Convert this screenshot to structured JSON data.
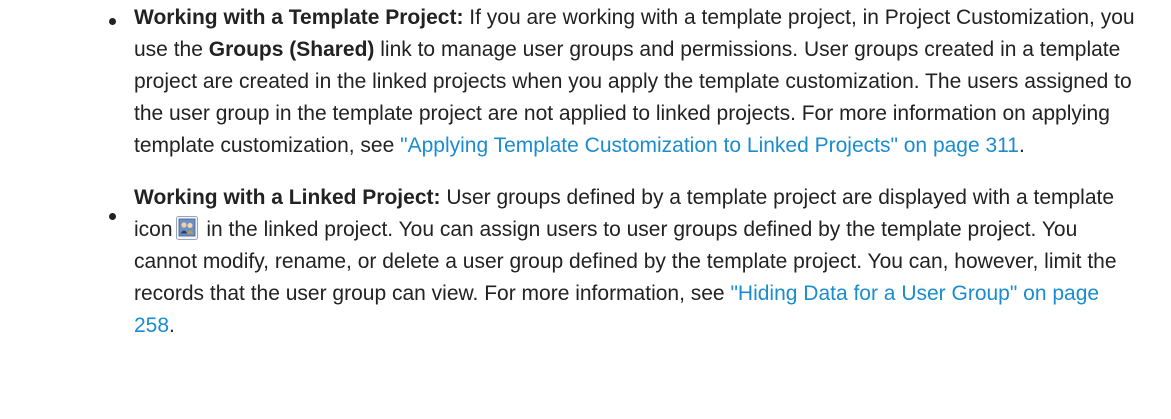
{
  "bullets": [
    {
      "heading": "Working with a Template Project:",
      "text_before": " If you are working with a template project, in Project Customization, you use the ",
      "bold_term": "Groups (Shared)",
      "text_after": " link to manage user groups and permissions. User groups created in a template project are created in the linked projects when you apply the template customization. The users assigned to the user group in the template project are not applied to linked projects. For more information on applying template customization, see ",
      "link": "\"Applying Template Customization to Linked Projects\" on page 311",
      "text_end": "."
    },
    {
      "heading": "Working with a Linked Project:",
      "text_before": " User groups defined by a template project are displayed with a template icon",
      "icon": "template-users-icon",
      "text_after": " in the linked project. You can assign users to user groups defined by the template project. You cannot modify, rename, or delete a user group defined by the template project. You can, however, limit the records that the user group can view. For more information, see ",
      "link": "\"Hiding Data for a User Group\" on page 258",
      "text_end": "."
    }
  ],
  "colors": {
    "text": "#222222",
    "link": "#1a8ccf"
  }
}
